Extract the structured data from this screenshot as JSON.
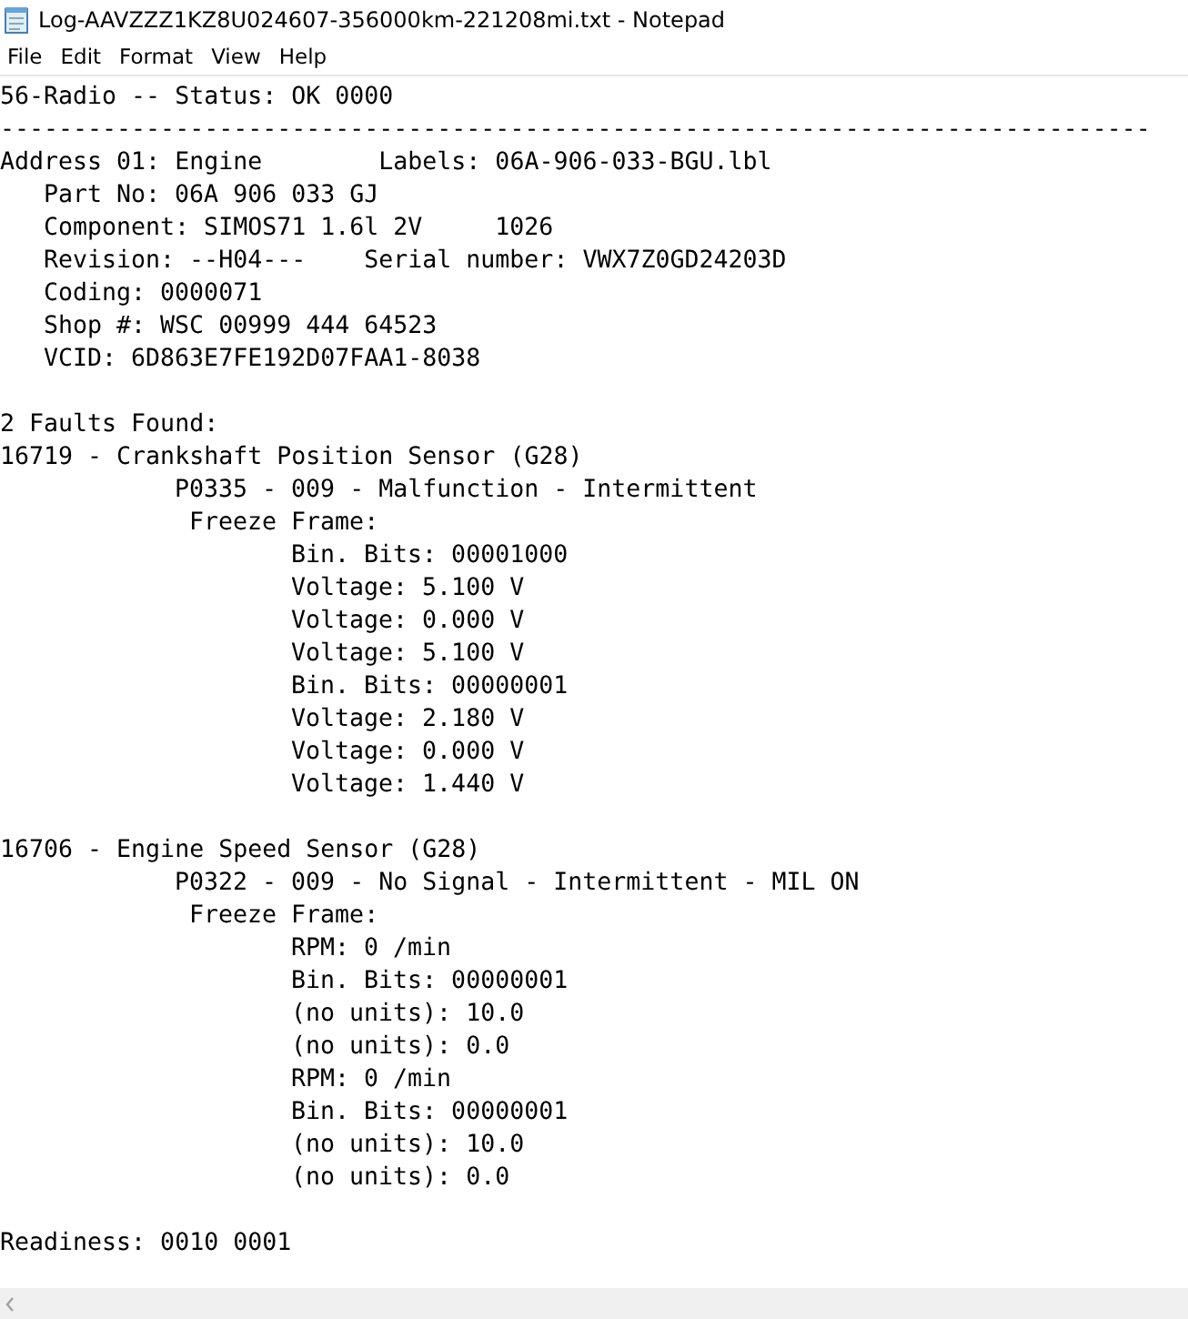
{
  "window": {
    "title": "Log-AAVZZZ1KZ8U024607-356000km-221208mi.txt - Notepad"
  },
  "menu": [
    "File",
    "Edit",
    "Format",
    "View",
    "Help"
  ],
  "lines": [
    {
      "kind": "top",
      "text": "56-Radio -- Status: OK 0000"
    },
    {
      "kind": "top",
      "text": "-------------------------------------------------------------------------------"
    },
    {
      "kind": "top",
      "text": "Address 01: Engine        Labels: 06A-906-033-BGU.lbl"
    },
    {
      "kind": "field",
      "text": "Part No: 06A 906 033 GJ"
    },
    {
      "kind": "field",
      "text": "Component: SIMOS71 1.6l 2V     1026"
    },
    {
      "kind": "field",
      "text": "Revision: --H04---    Serial number: VWX7Z0GD24203D"
    },
    {
      "kind": "field",
      "text": "Coding: 0000071"
    },
    {
      "kind": "field",
      "text": "Shop #: WSC 00999 444 64523"
    },
    {
      "kind": "field",
      "text": "VCID: 6D863E7FE192D07FAA1-8038"
    },
    {
      "kind": "blank"
    },
    {
      "kind": "top",
      "text": "2 Faults Found:"
    },
    {
      "kind": "top",
      "text": "16719 - Crankshaft Position Sensor (G28)"
    },
    {
      "kind": "code",
      "text": "P0335 - 009 - Malfunction - Intermittent"
    },
    {
      "kind": "freeze",
      "text": "Freeze Frame:"
    },
    {
      "kind": "value",
      "text": "Bin. Bits: 00001000"
    },
    {
      "kind": "value",
      "text": "Voltage: 5.100 V"
    },
    {
      "kind": "value",
      "text": "Voltage: 0.000 V"
    },
    {
      "kind": "value",
      "text": "Voltage: 5.100 V"
    },
    {
      "kind": "value",
      "text": "Bin. Bits: 00000001"
    },
    {
      "kind": "value",
      "text": "Voltage: 2.180 V"
    },
    {
      "kind": "value",
      "text": "Voltage: 0.000 V"
    },
    {
      "kind": "value",
      "text": "Voltage: 1.440 V"
    },
    {
      "kind": "blank"
    },
    {
      "kind": "top",
      "text": "16706 - Engine Speed Sensor (G28)"
    },
    {
      "kind": "code",
      "text": "P0322 - 009 - No Signal - Intermittent - MIL ON"
    },
    {
      "kind": "freeze",
      "text": "Freeze Frame:"
    },
    {
      "kind": "value",
      "text": "RPM: 0 /min"
    },
    {
      "kind": "value",
      "text": "Bin. Bits: 00000001"
    },
    {
      "kind": "value",
      "text": "(no units): 10.0"
    },
    {
      "kind": "value",
      "text": "(no units): 0.0"
    },
    {
      "kind": "value",
      "text": "RPM: 0 /min"
    },
    {
      "kind": "value",
      "text": "Bin. Bits: 00000001"
    },
    {
      "kind": "value",
      "text": "(no units): 10.0"
    },
    {
      "kind": "value",
      "text": "(no units): 0.0"
    },
    {
      "kind": "blank"
    },
    {
      "kind": "top",
      "text": "Readiness: 0010 0001"
    }
  ]
}
